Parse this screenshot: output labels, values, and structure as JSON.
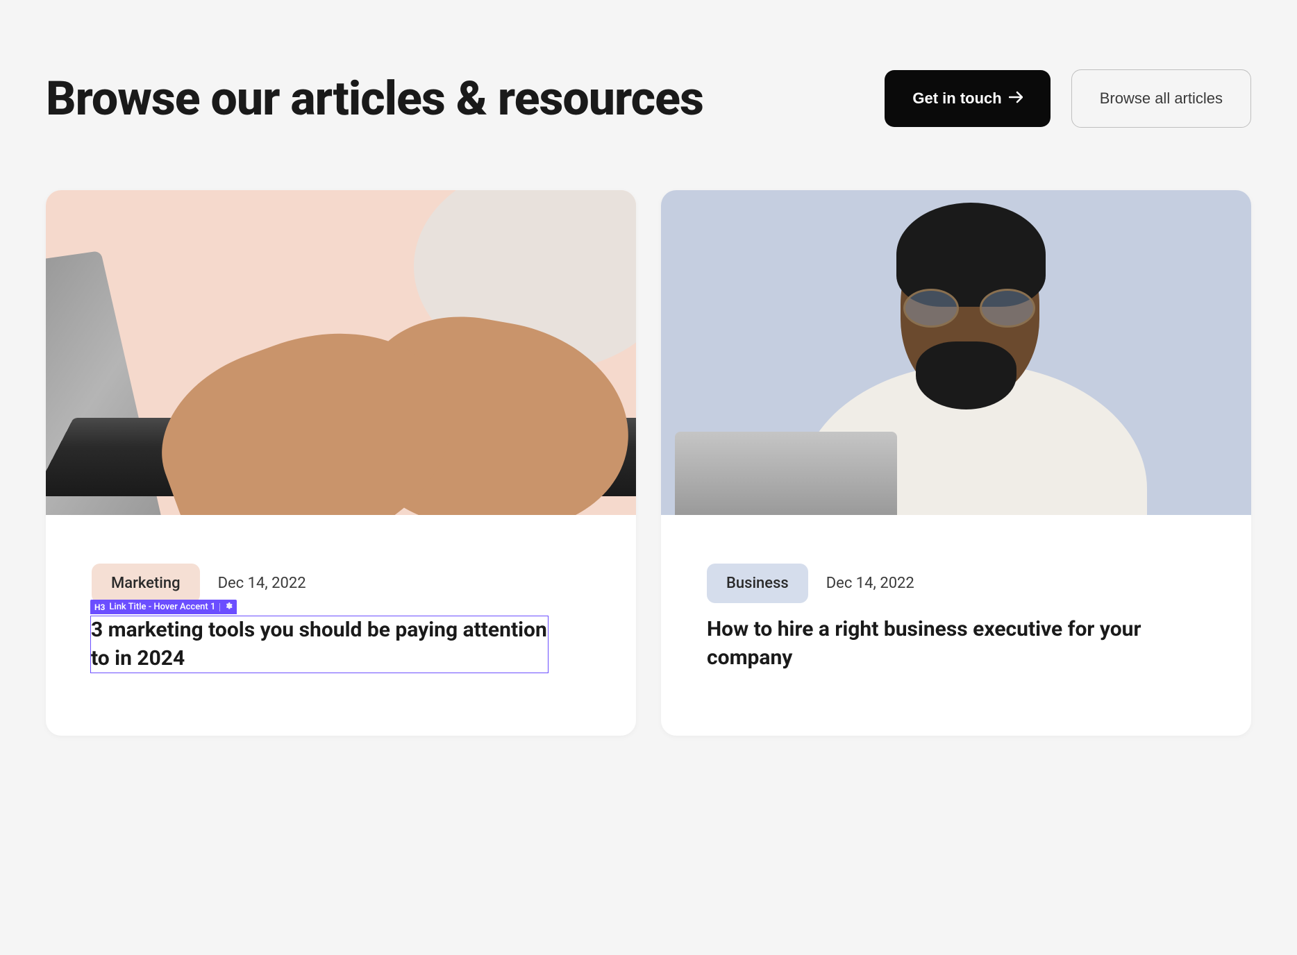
{
  "header": {
    "title": "Browse our articles & resources",
    "cta_primary": "Get in touch",
    "cta_secondary": "Browse all articles"
  },
  "inspector": {
    "element_tag": "H3",
    "element_class": "Link Title - Hover Accent 1",
    "gear_icon": "gear-icon"
  },
  "cards": [
    {
      "category": "Marketing",
      "date": "Dec 14, 2022",
      "title": "3 marketing tools you should be paying attention to in 2024",
      "badge_style": "peach",
      "image_style": "peach",
      "selected": true
    },
    {
      "category": "Business",
      "date": "Dec 14, 2022",
      "title": "How to hire a right business executive for your company",
      "badge_style": "blue",
      "image_style": "blue",
      "selected": false
    }
  ]
}
